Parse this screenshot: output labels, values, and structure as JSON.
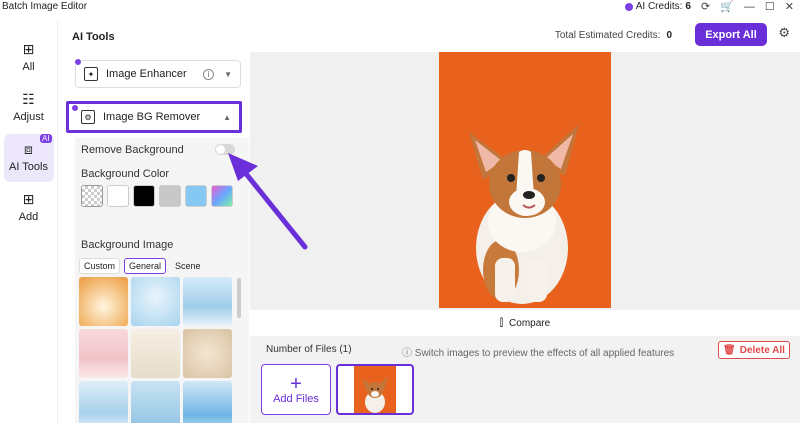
{
  "window": {
    "title": "Batch Image Editor",
    "credits_label": "AI Credits:",
    "credits_value": "6"
  },
  "nav": [
    {
      "label": "All",
      "icon": "grid-icon"
    },
    {
      "label": "Adjust",
      "icon": "sliders-icon"
    },
    {
      "label": "AI Tools",
      "icon": "ai-icon",
      "badge": "AI"
    },
    {
      "label": "Add",
      "icon": "plus-square-icon"
    }
  ],
  "tools": {
    "heading": "AI Tools",
    "enhancer": "Image Enhancer",
    "bg_remover": "Image BG Remover",
    "remove_bg": "Remove Background",
    "bg_color": "Background Color",
    "bg_image": "Background Image",
    "tabs": [
      "Custom",
      "General",
      "Scene"
    ],
    "colors": [
      "transparent",
      "#ffffff",
      "#000000",
      "#c8c8c8",
      "#86c8f4",
      "gradient"
    ]
  },
  "topbar": {
    "estimated_label": "Total Estimated Credits:",
    "estimated_value": "0",
    "export": "Export All"
  },
  "compare": "Compare",
  "files": {
    "count": "Number of Files (1)",
    "hint": "Switch images to preview the effects of all applied features",
    "delete_all": "Delete All",
    "add_files": "Add Files"
  },
  "accent": "#6a2fd8"
}
